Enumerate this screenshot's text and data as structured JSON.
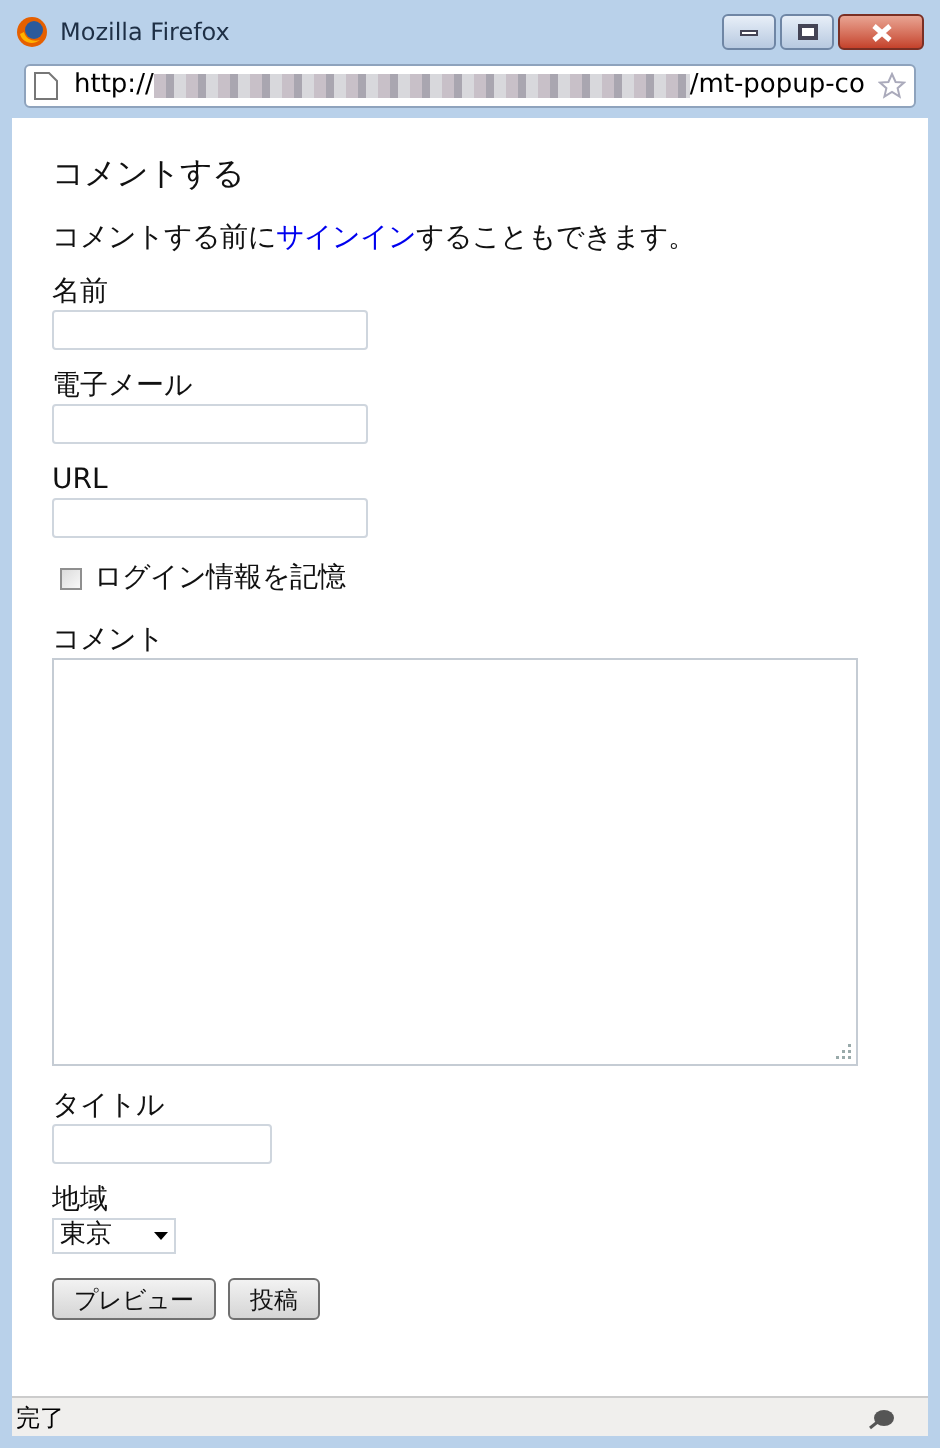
{
  "window": {
    "title": "Mozilla Firefox"
  },
  "address_bar": {
    "url_start": "http://",
    "url_end": "/mt-popup-co"
  },
  "heading": "コメントする",
  "intro": {
    "before": "コメントする前に",
    "link": "サインイン",
    "after": "することもできます。"
  },
  "fields": [
    {
      "kind": "text",
      "label": "名前"
    },
    {
      "kind": "text",
      "label": "電子メール"
    },
    {
      "kind": "text",
      "label": "URL"
    },
    {
      "kind": "checkbox",
      "label": "ログイン情報を記憶",
      "checked": false
    },
    {
      "kind": "textarea",
      "label": "コメント"
    },
    {
      "kind": "short",
      "label": "タイトル"
    },
    {
      "kind": "select",
      "label": "地域",
      "value": "東京"
    }
  ],
  "buttons": [
    "プレビュー",
    "投稿"
  ],
  "status_bar": {
    "text": "完了"
  }
}
